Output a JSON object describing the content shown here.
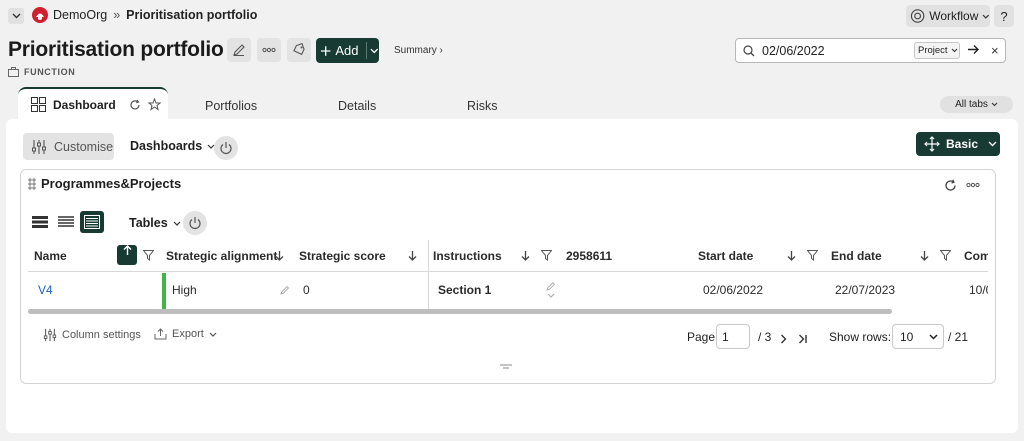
{
  "breadcrumb": {
    "org": "DemoOrg",
    "separator": "»",
    "current": "Prioritisation portfolio"
  },
  "top_actions": {
    "workflow_label": "Workflow",
    "help_label": "?"
  },
  "header": {
    "title": "Prioritisation portfolio",
    "add_label": "Add",
    "summary_link": "Summary ›",
    "subtype": "FUNCTION"
  },
  "search": {
    "value": "02/06/2022",
    "scope": "Project",
    "clear_label": "×"
  },
  "tabs": {
    "active": "Dashboard",
    "items": [
      "Portfolios",
      "Details",
      "Risks"
    ],
    "all_tabs_label": "All tabs"
  },
  "toolbar": {
    "customise_label": "Customise",
    "dashboards_label": "Dashboards",
    "basic_label": "Basic"
  },
  "widget": {
    "title": "Programmes&Projects",
    "tables_label": "Tables"
  },
  "table": {
    "columns": [
      "Name",
      "Strategic alignment",
      "Strategic score",
      "Instructions",
      "2958611",
      "Start date",
      "End date",
      "Com"
    ],
    "rows": [
      {
        "name": "V4",
        "strategic_alignment": "High",
        "strategic_score": "0",
        "instructions": "Section 1",
        "col_2958611": "",
        "start_date": "02/06/2022",
        "end_date": "22/07/2023",
        "com": "10/0"
      }
    ]
  },
  "footer": {
    "column_settings_label": "Column settings",
    "export_label": "Export",
    "page_label": "Page",
    "page_value": "1",
    "page_total": "/ 3",
    "show_rows_label": "Show rows:",
    "rows_value": "10",
    "rows_total": "/ 21"
  },
  "colors": {
    "brand_dark": "#173a32",
    "link": "#1a62c4",
    "status_green": "#40b447",
    "org_red": "#d01f2e"
  }
}
